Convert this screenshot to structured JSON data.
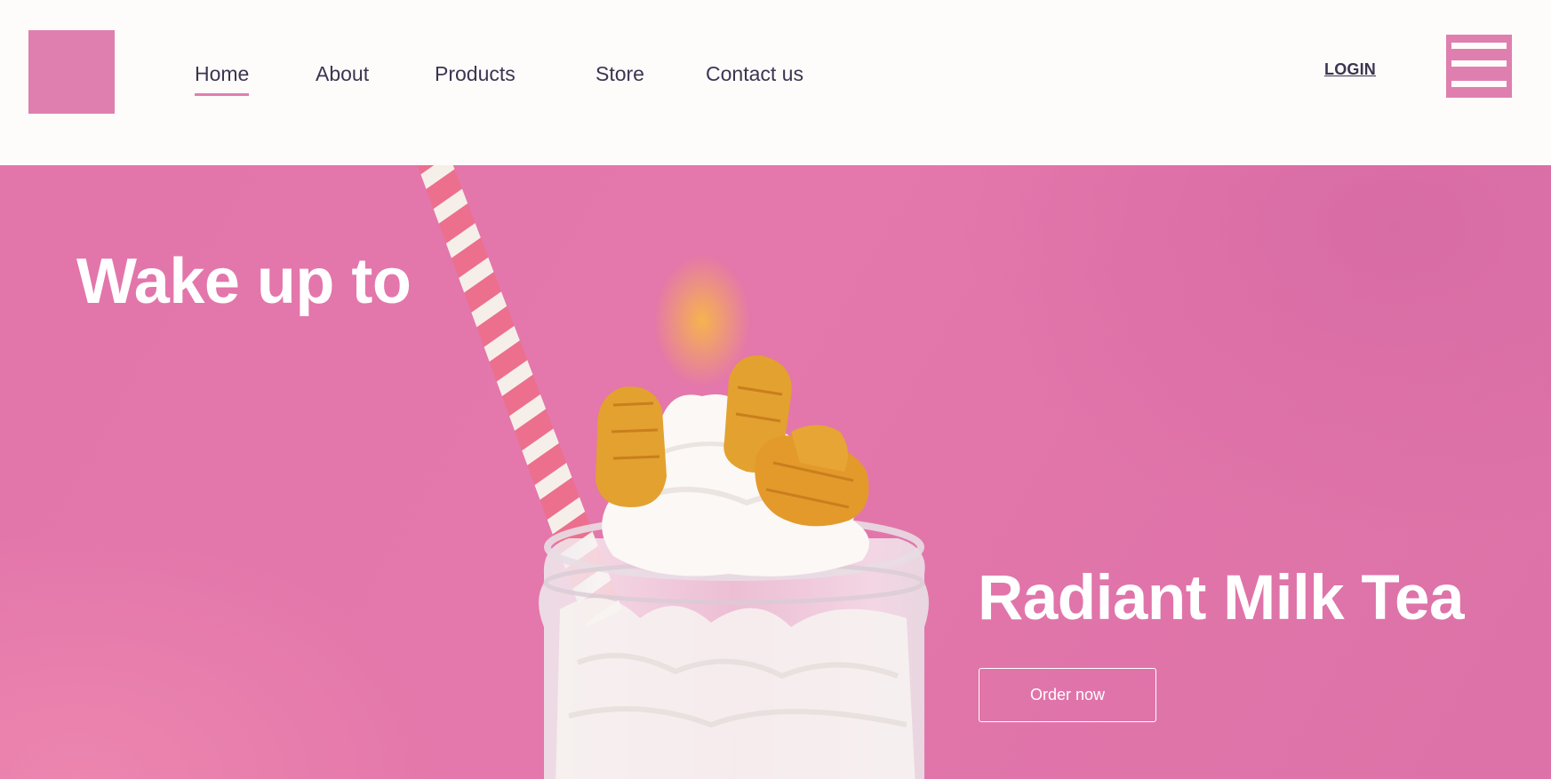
{
  "header": {
    "logo": "logo-placeholder",
    "nav": [
      {
        "label": "Home",
        "active": true
      },
      {
        "label": "About",
        "active": false
      },
      {
        "label": "Products",
        "active": false
      },
      {
        "label": "Store",
        "active": false
      },
      {
        "label": "Contact us",
        "active": false
      }
    ],
    "login_label": "LOGIN",
    "menu_icon": "hamburger-menu-icon"
  },
  "hero": {
    "heading": "Wake up to",
    "product_title": "Radiant Milk Tea",
    "order_button_label": "Order now",
    "image": "milkshake-with-whipped-cream-cereal-and-striped-straw"
  },
  "colors": {
    "accent": "#df7faf",
    "hero_background": "#e477ab",
    "text_dark": "#3a3650",
    "header_background": "#fefcfb",
    "white": "#ffffff"
  }
}
